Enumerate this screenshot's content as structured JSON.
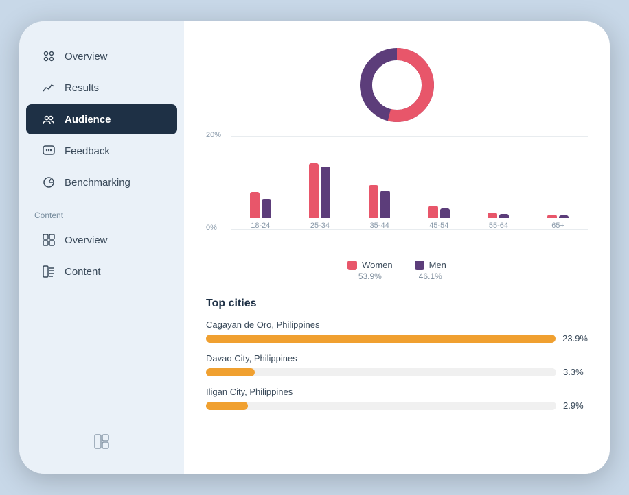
{
  "sidebar": {
    "nav_items": [
      {
        "id": "overview",
        "label": "Overview",
        "icon": "overview",
        "active": false
      },
      {
        "id": "results",
        "label": "Results",
        "icon": "results",
        "active": false
      },
      {
        "id": "audience",
        "label": "Audience",
        "icon": "audience",
        "active": true
      },
      {
        "id": "feedback",
        "label": "Feedback",
        "icon": "feedback",
        "active": false
      },
      {
        "id": "benchmarking",
        "label": "Benchmarking",
        "icon": "benchmarking",
        "active": false
      }
    ],
    "content_section_label": "Content",
    "content_items": [
      {
        "id": "content-overview",
        "label": "Overview",
        "icon": "content-overview"
      },
      {
        "id": "content-content",
        "label": "Content",
        "icon": "content-content"
      }
    ]
  },
  "main": {
    "donut": {
      "women_pct": 53.9,
      "men_pct": 46.1,
      "women_color": "#e8566a",
      "men_color": "#5c3d7a"
    },
    "bar_chart": {
      "y_labels": [
        "20%",
        "0%"
      ],
      "age_groups": [
        {
          "label": "18-24",
          "women": 38,
          "men": 28
        },
        {
          "label": "25-34",
          "women": 80,
          "men": 75
        },
        {
          "label": "35-44",
          "women": 48,
          "men": 40
        },
        {
          "label": "45-54",
          "women": 18,
          "men": 14
        },
        {
          "label": "55-64",
          "women": 8,
          "men": 6
        },
        {
          "label": "65+",
          "women": 5,
          "men": 4
        }
      ],
      "max_pct": 20
    },
    "legend": {
      "women_label": "Women",
      "women_pct": "53.9%",
      "men_label": "Men",
      "men_pct": "46.1%"
    },
    "top_cities_title": "Top cities",
    "cities": [
      {
        "name": "Cagayan de Oro, Philippines",
        "pct": 23.9,
        "pct_label": "23.9%"
      },
      {
        "name": "Davao City, Philippines",
        "pct": 3.3,
        "pct_label": "3.3%"
      },
      {
        "name": "Iligan City, Philippines",
        "pct": 2.9,
        "pct_label": "2.9%"
      }
    ]
  }
}
